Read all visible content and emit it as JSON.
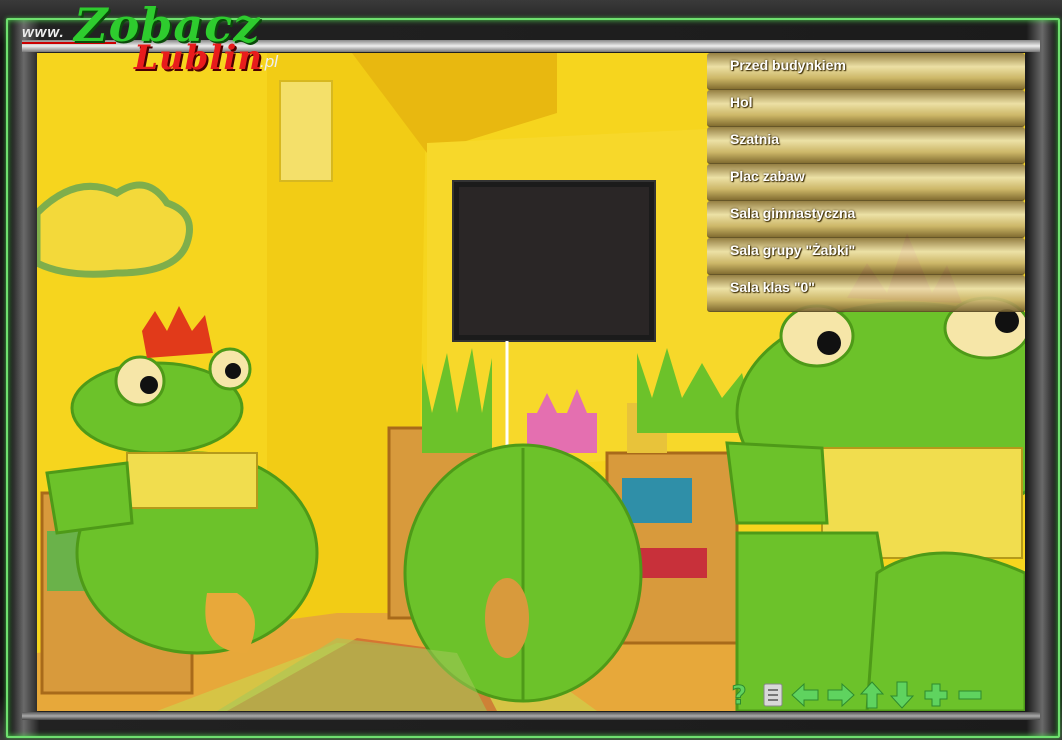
{
  "logo": {
    "www": "www.",
    "zobacz": "Zobacz",
    "lublin": "Lublin",
    "pl": ".pl"
  },
  "menu": {
    "items": [
      {
        "label": "Przed budynkiem"
      },
      {
        "label": "Hol"
      },
      {
        "label": "Szatnia"
      },
      {
        "label": "Plac zabaw"
      },
      {
        "label": "Sala gimnastyczna"
      },
      {
        "label": "Sala grupy \"Żabki\""
      },
      {
        "label": "Sala klas \"0\""
      }
    ]
  },
  "controls": {
    "items": [
      {
        "icon": "help-icon"
      },
      {
        "icon": "list-icon"
      },
      {
        "icon": "arrow-left-icon"
      },
      {
        "icon": "arrow-right-icon"
      },
      {
        "icon": "arrow-up-icon"
      },
      {
        "icon": "arrow-down-icon"
      },
      {
        "icon": "zoom-in-icon"
      },
      {
        "icon": "zoom-out-icon"
      }
    ],
    "color": "#5fd35f"
  },
  "colors": {
    "frame_green": "#6fe06f",
    "wall_yellow": "#f5d11c",
    "frog_green": "#6cc22a"
  }
}
